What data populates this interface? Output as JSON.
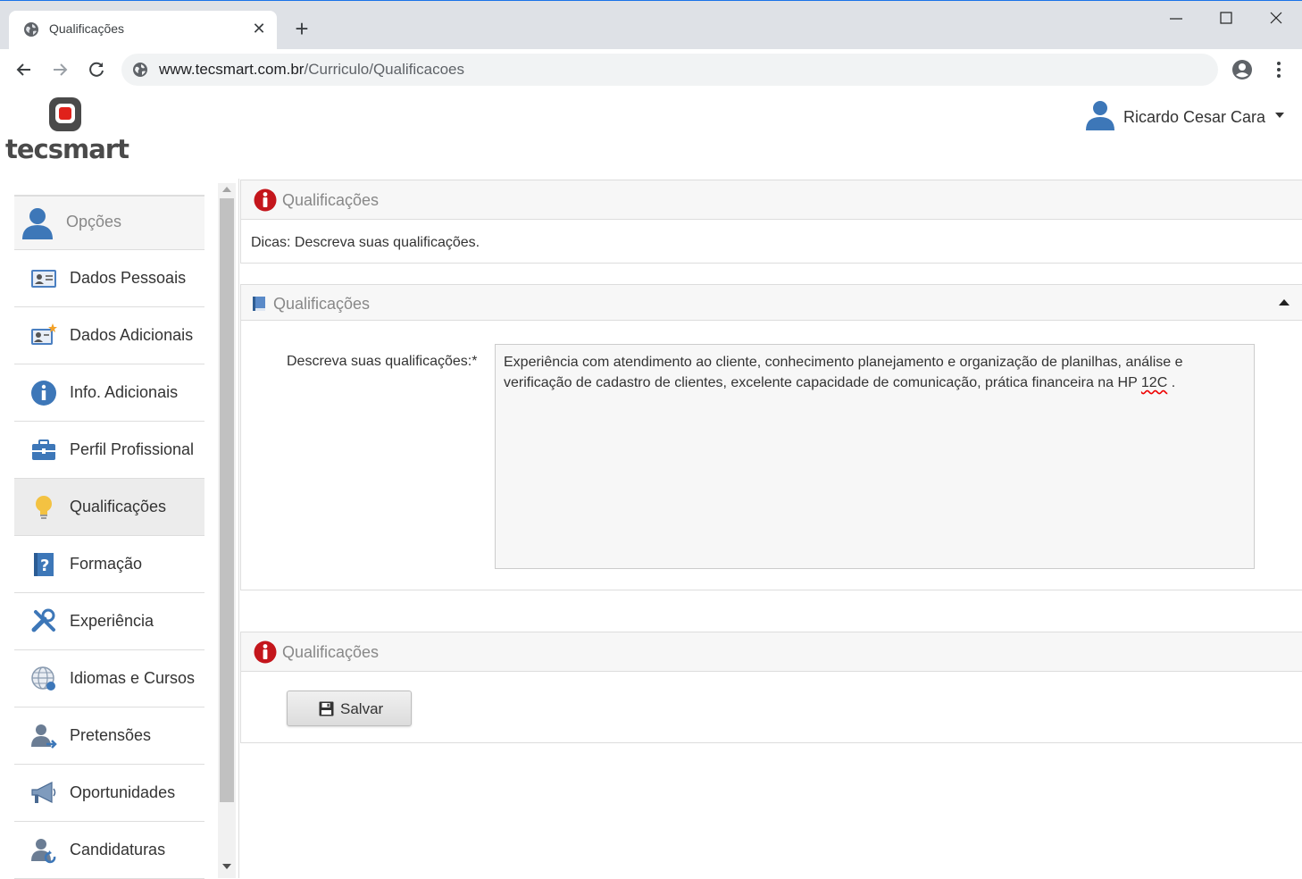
{
  "browser": {
    "tab_title": "Qualificações",
    "tab_close": "✕",
    "new_tab": "+",
    "url_host": "www.tecsmart.com.br",
    "url_path": "/Curriculo/Qualificacoes",
    "window_controls": [
      "minimize-icon",
      "maximize-icon",
      "close-icon"
    ]
  },
  "header": {
    "logo_text": "tecsmart",
    "user_name": "Ricardo Cesar Cara"
  },
  "sidebar": {
    "header_label": "Opções",
    "items": [
      {
        "label": "Dados Pessoais",
        "icon": "id-card-icon"
      },
      {
        "label": "Dados Adicionais",
        "icon": "id-card-star-icon"
      },
      {
        "label": "Info. Adicionais",
        "icon": "info-icon"
      },
      {
        "label": "Perfil Profissional",
        "icon": "briefcase-icon"
      },
      {
        "label": "Qualificações",
        "icon": "lightbulb-icon",
        "active": true
      },
      {
        "label": "Formação",
        "icon": "question-book-icon"
      },
      {
        "label": "Experiência",
        "icon": "tools-icon"
      },
      {
        "label": "Idiomas e Cursos",
        "icon": "globe-icon"
      },
      {
        "label": "Pretensões",
        "icon": "user-arrow-icon"
      },
      {
        "label": "Oportunidades",
        "icon": "megaphone-icon"
      },
      {
        "label": "Candidaturas",
        "icon": "user-refresh-icon"
      }
    ]
  },
  "main": {
    "tips_panel": {
      "title": "Qualificações",
      "text": "Dicas: Descreva suas qualificações."
    },
    "form_panel": {
      "title": "Qualificações",
      "field_label": "Descreva suas qualificações:*",
      "field_value_before": "Experiência com atendimento ao cliente, conhecimento planejamento e organização de planilhas, análise e verificação de cadastro de clientes, excelente capacidade de comunicação, prática financeira na HP ",
      "field_value_misspelled": "12C",
      "field_value_after": " ."
    },
    "actions_panel": {
      "title": "Qualificações",
      "save_label": "Salvar"
    }
  },
  "colors": {
    "accent_blue": "#1a73e8",
    "info_red": "#c4161c",
    "user_blue": "#3d77b8",
    "bulb_yellow": "#f3c242"
  }
}
